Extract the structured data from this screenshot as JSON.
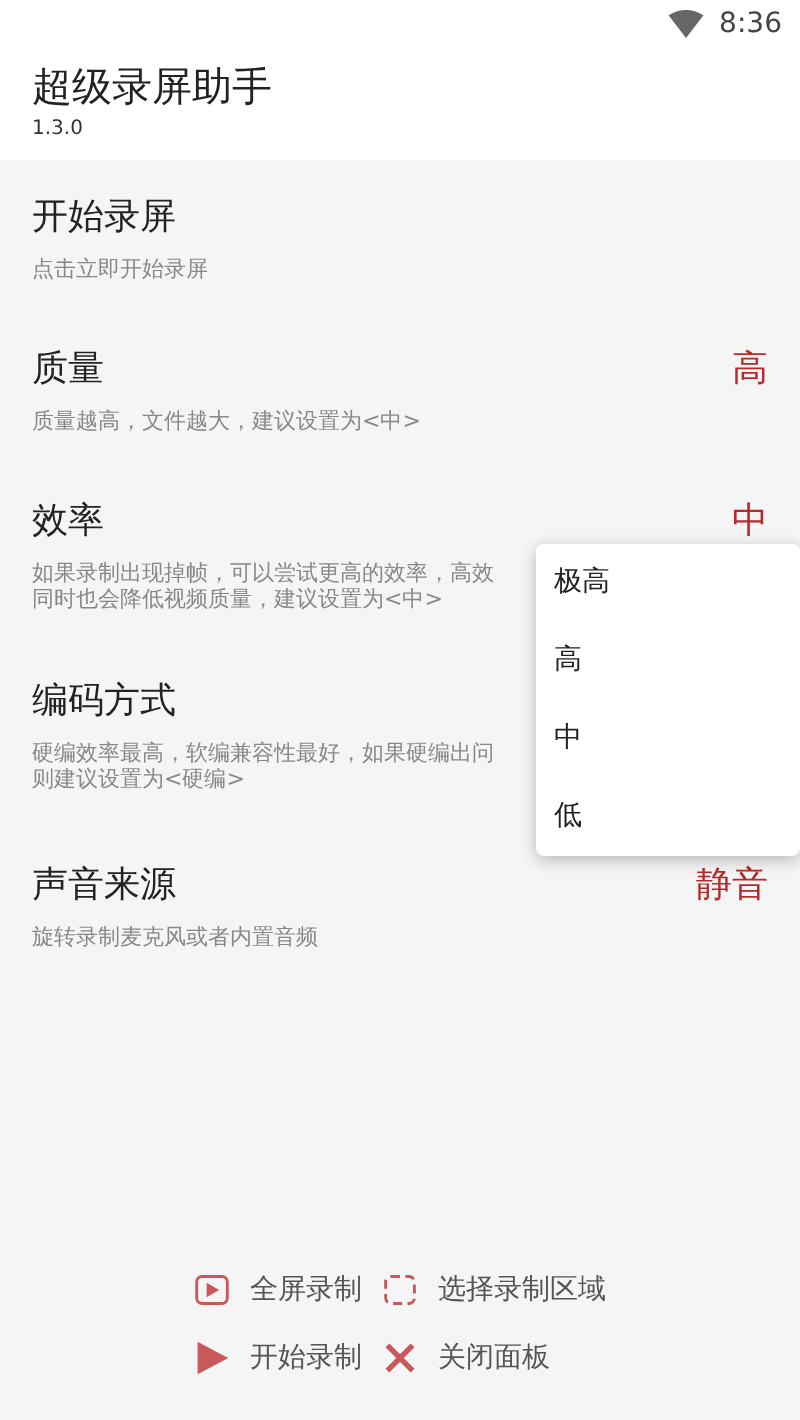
{
  "status_bar": {
    "time": "8:36"
  },
  "app": {
    "title": "超级录屏助手",
    "version": "1.3.0"
  },
  "settings": [
    {
      "title": "开始录屏",
      "description": [
        "点击立即开始录屏"
      ]
    },
    {
      "title": "质量",
      "value": "高",
      "description": [
        "质量越高，文件越大，建议设置为<中>"
      ]
    },
    {
      "title": "效率",
      "value": "中",
      "description": [
        "如果录制出现掉帧，可以尝试更高的效率，高效",
        "同时也会降低视频质量，建议设置为<中>"
      ]
    },
    {
      "title": "编码方式",
      "description": [
        "硬编效率最高，软编兼容性最好，如果硬编出问",
        "则建议设置为<硬编>"
      ]
    },
    {
      "title": "声音来源",
      "value": "静音",
      "description": [
        "旋转录制麦克风或者内置音频"
      ]
    }
  ],
  "dropdown_menu": [
    "极高",
    "高",
    "中",
    "低"
  ],
  "actions": [
    {
      "kind": "fullscreen",
      "label": "全屏录制"
    },
    {
      "kind": "region",
      "label": "选择录制区域"
    },
    {
      "kind": "start",
      "label": "开始录制"
    },
    {
      "kind": "close",
      "label": "关闭面板"
    }
  ]
}
